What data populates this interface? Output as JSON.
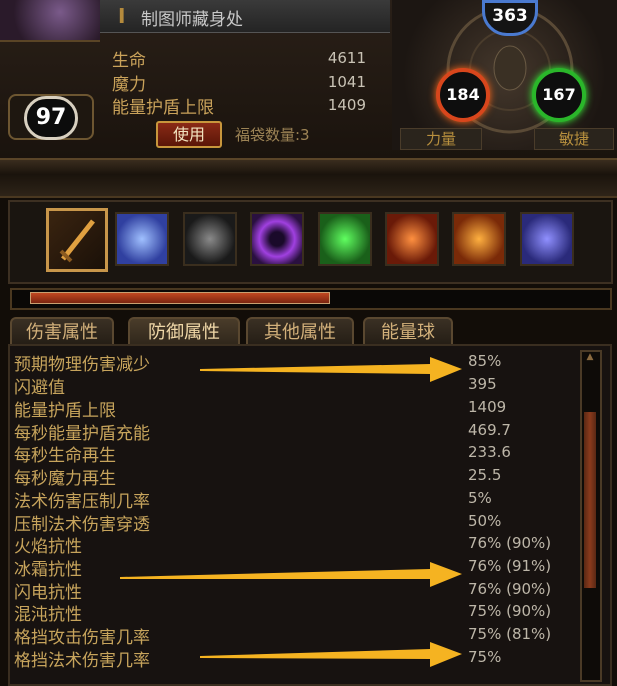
{
  "header": {
    "title_mark": "I",
    "title": "制图师藏身处"
  },
  "stats": [
    {
      "label": "生命",
      "value": "4611"
    },
    {
      "label": "魔力",
      "value": "1041"
    },
    {
      "label": "能量护盾上限",
      "value": "1409"
    }
  ],
  "level": "97",
  "use_button": "使用",
  "bag_count": "福袋数量:3",
  "orbs": {
    "top": "363",
    "strength": "184",
    "dexterity": "167",
    "strength_label": "力量",
    "dexterity_label": "敏捷"
  },
  "skills": [
    "sword-skill-icon",
    "spirit-figure-icon",
    "shadow-figure-icon",
    "vortex-eye-icon",
    "green-tombstone-icon",
    "fire-fist-icon",
    "fire-swirl-icon",
    "blue-shield-icon"
  ],
  "progress": 0.53,
  "tabs": [
    "伤害属性",
    "防御属性",
    "其他属性",
    "能量球"
  ],
  "active_tab": 1,
  "defense_rows": [
    {
      "label": "预期物理伤害减少",
      "value": "85%"
    },
    {
      "label": "闪避值",
      "value": "395"
    },
    {
      "label": "能量护盾上限",
      "value": "1409"
    },
    {
      "label": "每秒能量护盾充能",
      "value": "469.7"
    },
    {
      "label": "每秒生命再生",
      "value": "233.6"
    },
    {
      "label": "每秒魔力再生",
      "value": "25.5"
    },
    {
      "label": "法术伤害压制几率",
      "value": "5%"
    },
    {
      "label": "压制法术伤害穿透",
      "value": "50%"
    },
    {
      "label": "火焰抗性",
      "value": "76% (90%)"
    },
    {
      "label": "冰霜抗性",
      "value": "76% (91%)"
    },
    {
      "label": "闪电抗性",
      "value": "76% (90%)"
    },
    {
      "label": "混沌抗性",
      "value": "75% (90%)"
    },
    {
      "label": "格挡攻击伤害几率",
      "value": "75% (81%)"
    },
    {
      "label": "格挡法术伤害几率",
      "value": "75%"
    }
  ],
  "colors": {
    "accent_gold": "#c9a25a",
    "arrow": "#f5b321",
    "strength": "#d8461c",
    "dexterity": "#2ab62a",
    "top_orb": "#4a7ad0"
  }
}
